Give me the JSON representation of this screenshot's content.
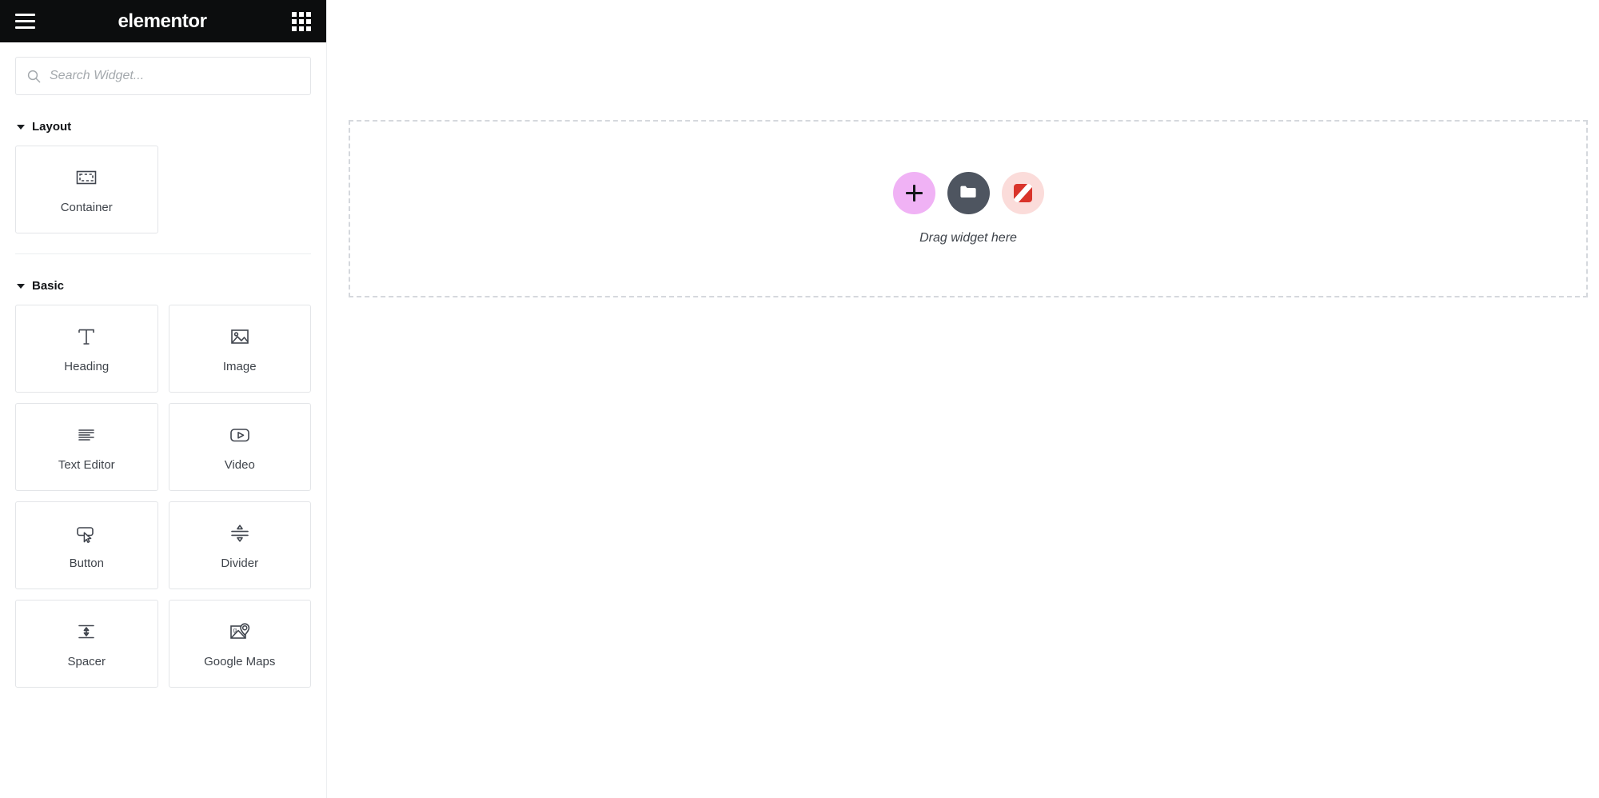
{
  "header": {
    "brand": "elementor",
    "menu_icon": "hamburger-icon",
    "grid_icon": "apps-grid-icon"
  },
  "search": {
    "placeholder": "Search Widget...",
    "value": "",
    "icon": "search-icon"
  },
  "sections": [
    {
      "title": "Layout",
      "expanded": true,
      "widgets": [
        {
          "label": "Container",
          "icon": "container-icon"
        }
      ]
    },
    {
      "title": "Basic",
      "expanded": true,
      "widgets": [
        {
          "label": "Heading",
          "icon": "heading-icon"
        },
        {
          "label": "Image",
          "icon": "image-icon"
        },
        {
          "label": "Text Editor",
          "icon": "text-editor-icon"
        },
        {
          "label": "Video",
          "icon": "video-icon"
        },
        {
          "label": "Button",
          "icon": "button-icon"
        },
        {
          "label": "Divider",
          "icon": "divider-icon"
        },
        {
          "label": "Spacer",
          "icon": "spacer-icon"
        },
        {
          "label": "Google Maps",
          "icon": "google-maps-icon"
        }
      ]
    }
  ],
  "panel_collapse": {
    "icon": "chevron-left-icon"
  },
  "canvas": {
    "drop_label": "Drag widget here",
    "buttons": [
      {
        "name": "add-new-element",
        "icon": "plus-icon",
        "color": "#f0b2f5"
      },
      {
        "name": "add-template",
        "icon": "folder-icon",
        "color": "#4e5560"
      },
      {
        "name": "ai-builder",
        "icon": "ai-badge-icon",
        "color": "#fbdcda"
      }
    ]
  },
  "colors": {
    "header_bg": "#0c0d0e",
    "panel_border": "#eceef0",
    "card_border": "#e3e5e8",
    "text": "#3f444b",
    "dash_border": "#d5d8dd",
    "accent_pink": "#f0b2f5",
    "accent_dark": "#4e5560",
    "accent_red": "#d9342b"
  }
}
